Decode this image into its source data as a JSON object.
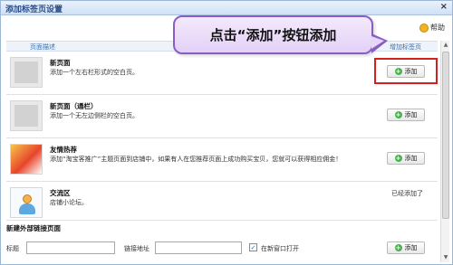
{
  "dialog": {
    "title": "添加标签页设置",
    "close_symbol": "×"
  },
  "help": {
    "label": "帮助"
  },
  "columns": {
    "page_desc": "页面描述",
    "add_tab": "增加标签页"
  },
  "rows": [
    {
      "title": "新页面",
      "desc": "添加一个左右栏形式的空白页。",
      "button": "添加"
    },
    {
      "title": "新页面（通栏）",
      "desc": "添加一个无左边侧栏的空白页。",
      "button": "添加"
    },
    {
      "title": "友情热荐",
      "desc": "添加“淘宝客推广”主题页面到店铺中，如果有人在您推荐页面上成功购买宝贝，您就可以获得相应佣金！",
      "button": "添加"
    },
    {
      "title": "交流区",
      "desc": "店铺小论坛。",
      "status": "已经添加了"
    }
  ],
  "external": {
    "section_title": "新建外部链接页面",
    "title_label": "标题",
    "title_value": "",
    "link_label": "链接地址",
    "link_value": "",
    "checkbox_checked": true,
    "checkbox_label": "在新窗口打开",
    "button": "添加"
  },
  "callout": {
    "text": "点击“添加”按钮添加"
  },
  "colors": {
    "highlight": "#d32020",
    "callout_border": "#8a5cc6"
  }
}
